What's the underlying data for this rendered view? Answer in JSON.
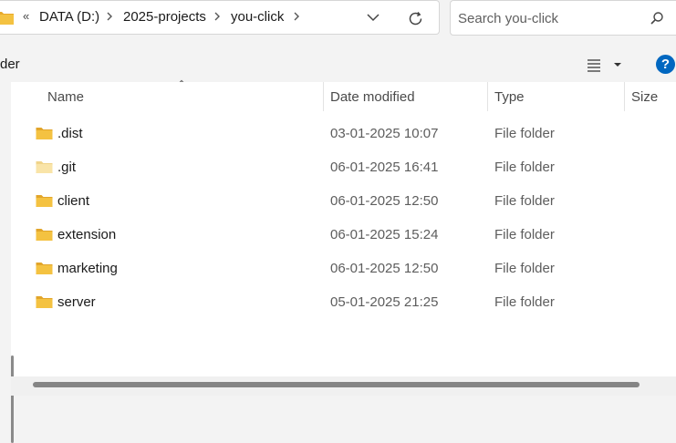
{
  "address": {
    "overflow": "«",
    "crumbs": [
      "DATA (D:)",
      "2025-projects",
      "you-click"
    ]
  },
  "search": {
    "placeholder": "Search you-click"
  },
  "command": {
    "truncated_label": "der",
    "help": "?"
  },
  "columns": {
    "name": "Name",
    "date": "Date modified",
    "type": "Type",
    "size": "Size"
  },
  "colors": {
    "accent": "#0067c0",
    "folder": "#f4c241",
    "folder_hidden": "#f9e4a8"
  },
  "files": [
    {
      "name": ".dist",
      "date": "03-01-2025 10:07",
      "type": "File folder",
      "icon": "folder-icon"
    },
    {
      "name": ".git",
      "date": "06-01-2025 16:41",
      "type": "File folder",
      "icon": "hidden-folder-icon"
    },
    {
      "name": "client",
      "date": "06-01-2025 12:50",
      "type": "File folder",
      "icon": "folder-icon"
    },
    {
      "name": "extension",
      "date": "06-01-2025 15:24",
      "type": "File folder",
      "icon": "folder-icon"
    },
    {
      "name": "marketing",
      "date": "06-01-2025 12:50",
      "type": "File folder",
      "icon": "folder-icon"
    },
    {
      "name": "server",
      "date": "05-01-2025 21:25",
      "type": "File folder",
      "icon": "folder-icon"
    }
  ]
}
